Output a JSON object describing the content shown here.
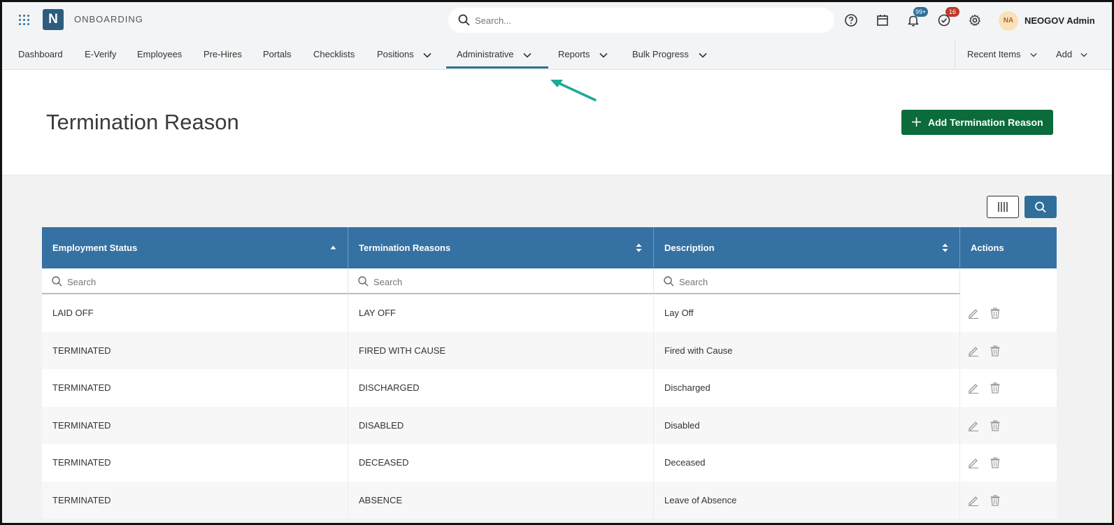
{
  "app": {
    "logo_letter": "N",
    "title": "ONBOARDING",
    "search_placeholder": "Search...",
    "notifications_badge": "99+",
    "tasks_badge": "16",
    "user_initials": "NA",
    "user_name": "NEOGOV Admin"
  },
  "nav": {
    "items": [
      {
        "label": "Dashboard"
      },
      {
        "label": "E-Verify"
      },
      {
        "label": "Employees"
      },
      {
        "label": "Pre-Hires"
      },
      {
        "label": "Portals"
      },
      {
        "label": "Checklists"
      },
      {
        "label": "Positions"
      },
      {
        "label": "Administrative"
      },
      {
        "label": "Reports"
      },
      {
        "label": "Bulk Progress"
      }
    ],
    "active": "Administrative",
    "recent_items": "Recent Items",
    "add": "Add"
  },
  "page": {
    "title": "Termination Reason",
    "add_button": "Add Termination Reason"
  },
  "table": {
    "headers": [
      "Employment Status",
      "Termination Reasons",
      "Description",
      "Actions"
    ],
    "filter_placeholder": "Search",
    "rows": [
      {
        "status": "LAID OFF",
        "reason": "LAY OFF",
        "description": "Lay Off"
      },
      {
        "status": "TERMINATED",
        "reason": "FIRED WITH CAUSE",
        "description": "Fired with Cause"
      },
      {
        "status": "TERMINATED",
        "reason": "DISCHARGED",
        "description": "Discharged"
      },
      {
        "status": "TERMINATED",
        "reason": "DISABLED",
        "description": "Disabled"
      },
      {
        "status": "TERMINATED",
        "reason": "DECEASED",
        "description": "Deceased"
      },
      {
        "status": "TERMINATED",
        "reason": "ABSENCE",
        "description": "Leave of Absence"
      }
    ]
  },
  "colors": {
    "brand": "#2d5c7f",
    "header_bg": "#3671a3",
    "add_button": "#0b6b3a",
    "annotation_arrow": "#1aaa96",
    "notifications_badge": "#2f6f9a",
    "tasks_badge": "#c0392b"
  }
}
